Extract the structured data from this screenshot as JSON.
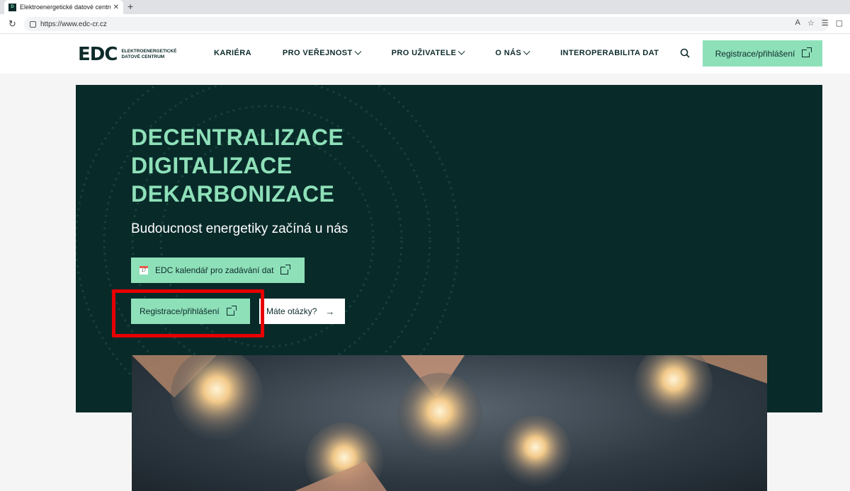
{
  "browser": {
    "tab_title": "Elektroenergetické datové centrum",
    "favicon_text": "D",
    "url": "https://www.edc-cr.cz"
  },
  "header": {
    "logo_mark": "EDC",
    "logo_text": "ELEKTROENERGETICKÉ DATOVÉ CENTRUM",
    "nav": [
      {
        "label": "KARIÉRA",
        "dropdown": false
      },
      {
        "label": "PRO VEŘEJNOST",
        "dropdown": true
      },
      {
        "label": "PRO UŽIVATELE",
        "dropdown": true
      },
      {
        "label": "O NÁS",
        "dropdown": true
      },
      {
        "label": "INTEROPERABILITA DAT",
        "dropdown": false
      }
    ],
    "cta_label": "Registrace/přihlášení"
  },
  "hero": {
    "headline": [
      "DECENTRALIZACE",
      "DIGITALIZACE",
      "DEKARBONIZACE"
    ],
    "subline": "Budoucnost energetiky začíná u nás",
    "calendar_button": "EDC kalendář pro zadávání dat",
    "calendar_icon_day": "17",
    "register_button": "Registrace/přihlášení",
    "questions_button": "Máte otázky?"
  },
  "colors": {
    "brand_dark": "#082a29",
    "accent_green": "#8ee0b9",
    "highlight_red": "#e60000"
  }
}
